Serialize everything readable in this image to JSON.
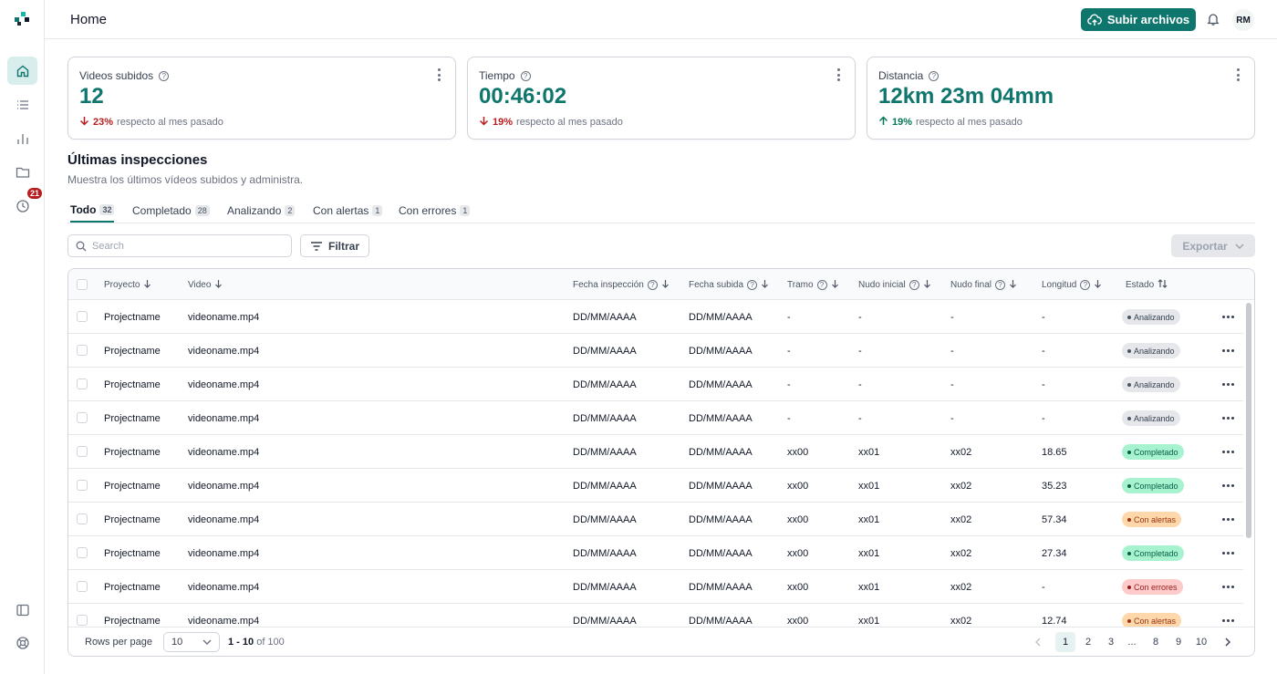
{
  "header": {
    "title": "Home",
    "upload_label": "Subir archivos",
    "avatar": "RM"
  },
  "sidebar": {
    "history_badge": "21",
    "items": [
      {
        "name": "home-icon"
      },
      {
        "name": "list-icon"
      },
      {
        "name": "chart-icon"
      },
      {
        "name": "folder-icon"
      },
      {
        "name": "clock-icon"
      },
      {
        "name": "panel-icon"
      },
      {
        "name": "help-circle-icon"
      }
    ]
  },
  "stats": [
    {
      "label": "Videos subidos",
      "value": "12",
      "direction": "down",
      "percent": "23%",
      "note": "respecto al mes pasado"
    },
    {
      "label": "Tiempo",
      "value": "00:46:02",
      "direction": "down",
      "percent": "19%",
      "note": "respecto al mes pasado"
    },
    {
      "label": "Distancia",
      "value": "12km 23m 04mm",
      "direction": "up",
      "percent": "19%",
      "note": "respecto al mes pasado"
    }
  ],
  "section": {
    "title": "Últimas inspecciones",
    "subtitle": "Muestra los últimos vídeos subidos y administra."
  },
  "tabs": [
    {
      "label": "Todo",
      "count": "32"
    },
    {
      "label": "Completado",
      "count": "28"
    },
    {
      "label": "Analizando",
      "count": "2"
    },
    {
      "label": "Con alertas",
      "count": "1"
    },
    {
      "label": "Con errores",
      "count": "1"
    }
  ],
  "toolbar": {
    "search_placeholder": "Search",
    "filter_label": "Filtrar",
    "export_label": "Exportar"
  },
  "table": {
    "columns": [
      "Proyecto",
      "Video",
      "Fecha inspección",
      "Fecha subida",
      "Tramo",
      "Nudo inicial",
      "Nudo final",
      "Longitud",
      "Estado"
    ],
    "rows": [
      [
        "Projectname",
        "videoname.mp4",
        "DD/MM/AAAA",
        "DD/MM/AAAA",
        "-",
        "-",
        "-",
        "-",
        "Analizando"
      ],
      [
        "Projectname",
        "videoname.mp4",
        "DD/MM/AAAA",
        "DD/MM/AAAA",
        "-",
        "-",
        "-",
        "-",
        "Analizando"
      ],
      [
        "Projectname",
        "videoname.mp4",
        "DD/MM/AAAA",
        "DD/MM/AAAA",
        "-",
        "-",
        "-",
        "-",
        "Analizando"
      ],
      [
        "Projectname",
        "videoname.mp4",
        "DD/MM/AAAA",
        "DD/MM/AAAA",
        "-",
        "-",
        "-",
        "-",
        "Analizando"
      ],
      [
        "Projectname",
        "videoname.mp4",
        "DD/MM/AAAA",
        "DD/MM/AAAA",
        "xx00",
        "xx01",
        "xx02",
        "18.65",
        "Completado"
      ],
      [
        "Projectname",
        "videoname.mp4",
        "DD/MM/AAAA",
        "DD/MM/AAAA",
        "xx00",
        "xx01",
        "xx02",
        "35.23",
        "Completado"
      ],
      [
        "Projectname",
        "videoname.mp4",
        "DD/MM/AAAA",
        "DD/MM/AAAA",
        "xx00",
        "xx01",
        "xx02",
        "57.34",
        "Con alertas"
      ],
      [
        "Projectname",
        "videoname.mp4",
        "DD/MM/AAAA",
        "DD/MM/AAAA",
        "xx00",
        "xx01",
        "xx02",
        "27.34",
        "Completado"
      ],
      [
        "Projectname",
        "videoname.mp4",
        "DD/MM/AAAA",
        "DD/MM/AAAA",
        "xx00",
        "xx01",
        "xx02",
        "-",
        "Con errores"
      ],
      [
        "Projectname",
        "videoname.mp4",
        "DD/MM/AAAA",
        "DD/MM/AAAA",
        "xx00",
        "xx01",
        "xx02",
        "12.74",
        "Con alertas"
      ]
    ]
  },
  "footer": {
    "rows_per_page_label": "Rows per page",
    "rows_per_page": "10",
    "range_bold": "1 - 10",
    "range_rest": " of 100",
    "pages": [
      "1",
      "2",
      "3",
      "...",
      "8",
      "9",
      "10"
    ]
  }
}
